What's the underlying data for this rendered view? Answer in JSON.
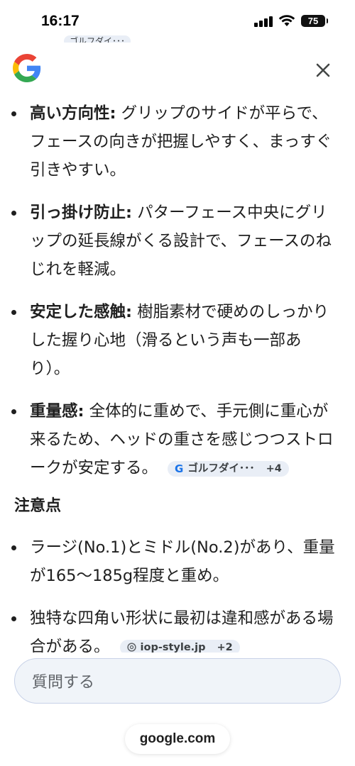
{
  "status_bar": {
    "time": "16:17",
    "battery": "75"
  },
  "peek": {
    "chip_text": "ゴルフダイ･･･"
  },
  "header": {
    "logo": "google-logo",
    "close_icon": "close-icon"
  },
  "bullets": [
    {
      "term": "高い方向性:",
      "text": " グリップのサイドが平らで、フェースの向きが把握しやすく、まっすぐ引きやすい。"
    },
    {
      "term": "引っ掛け防止:",
      "text": " パターフェース中央にグリップの延長線がくる設計で、フェースのねじれを軽減。"
    },
    {
      "term": "安定した感触:",
      "text": " 樹脂素材で硬めのしっかりした握り心地（滑るという声も一部あり）。"
    },
    {
      "term": "重量感:",
      "text": " 全体的に重めで、手元側に重心が来るため、ヘッドの重さを感じつつストロークが安定する。",
      "chip": {
        "icon": "google-g-icon",
        "label": "ゴルフダイ･･･",
        "more": "+4"
      }
    }
  ],
  "notes": {
    "title": "注意点",
    "items": [
      {
        "text": "ラージ(No.1)とミドル(No.2)があり、重量が165〜185g程度と重め。"
      },
      {
        "text": "独特な四角い形状に最初は違和感がある場合がある。",
        "chip": {
          "icon": "globe-icon",
          "label": "iop-style.jp",
          "more": "+2"
        }
      }
    ]
  },
  "ask": {
    "placeholder": "質問する"
  },
  "footer": {
    "domain": "google.com"
  },
  "colors": {
    "chip_bg": "#e9eef6",
    "ask_bg": "#f0f4f9",
    "ask_border": "#c8d2e8",
    "google_blue": "#4285F4",
    "google_red": "#EA4335",
    "google_yellow": "#FBBC05",
    "google_green": "#34A853"
  }
}
